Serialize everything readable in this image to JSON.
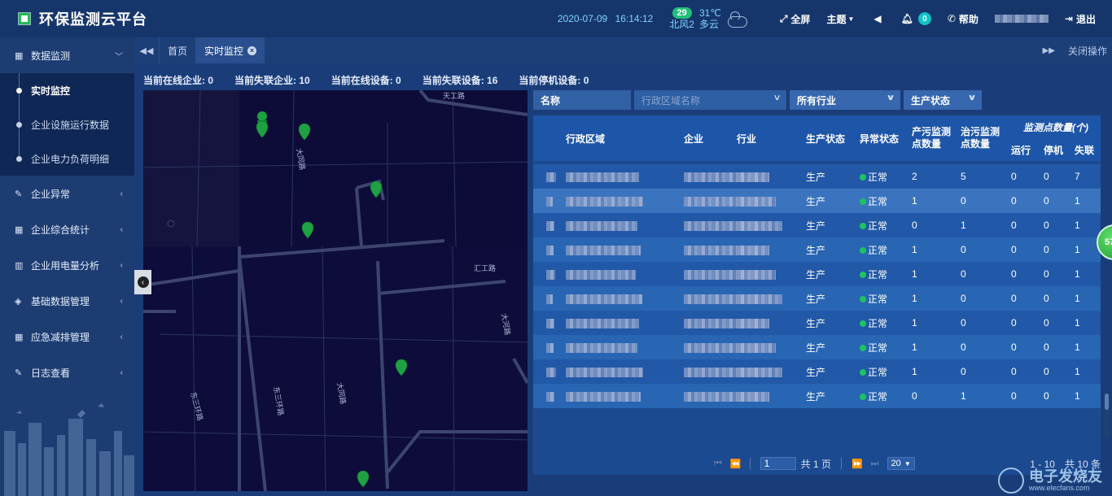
{
  "app": {
    "title": "环保监测云平台"
  },
  "header": {
    "date": "2020-07-09",
    "time": "16:14:12",
    "aqi": "29",
    "wind": "北风2",
    "temperature": "31℃",
    "weather": "多云",
    "fullscreen_label": "全屏",
    "theme_label": "主题",
    "notification_count": "0",
    "help_label": "帮助",
    "logout_label": "退出"
  },
  "sidebar": {
    "groups": [
      {
        "label": "数据监测",
        "icon": "calendar-icon"
      },
      {
        "label": "企业异常",
        "icon": "edit-icon"
      },
      {
        "label": "企业综合统计",
        "icon": "calendar-icon"
      },
      {
        "label": "企业用电量分析",
        "icon": "bar-chart-icon"
      },
      {
        "label": "基础数据管理",
        "icon": "layers-icon"
      },
      {
        "label": "应急减排管理",
        "icon": "calendar-icon"
      },
      {
        "label": "日志查看",
        "icon": "edit-icon"
      }
    ],
    "sub_items": [
      {
        "label": "实时监控"
      },
      {
        "label": "企业设施运行数据"
      },
      {
        "label": "企业电力负荷明细"
      }
    ]
  },
  "tabs": {
    "items": [
      {
        "label": "首页"
      },
      {
        "label": "实时监控"
      }
    ],
    "close_ops_label": "关闭操作"
  },
  "stats": {
    "online_enterprises": "当前在线企业: 0",
    "offline_enterprises": "当前失联企业: 10",
    "online_devices": "当前在线设备: 0",
    "offline_devices": "当前失联设备: 16",
    "stopped_devices": "当前停机设备: 0"
  },
  "map": {
    "road_labels": [
      "天工路",
      "大同路",
      "汇工路",
      "大河路",
      "大同路",
      "东三环路",
      "东三环路"
    ]
  },
  "filters": {
    "name_label": "名称",
    "region_placeholder": "行政区域名称",
    "industry_value": "所有行业",
    "status_value": "生产状态"
  },
  "table": {
    "headers": {
      "region": "行政区域",
      "enterprise": "企业",
      "industry": "行业",
      "prod_status": "生产状态",
      "abnormal_status": "异常状态",
      "pollution_points": "产污监测点数量",
      "treatment_points": "治污监测点数量",
      "monitor_points": "监测点数量(个)",
      "running": "运行",
      "stopped": "停机",
      "offline": "失联"
    },
    "rows": [
      {
        "status": "生产",
        "abnormal": "正常",
        "pollution": "2",
        "treatment": "5",
        "running": "0",
        "stopped": "0",
        "offline": "7"
      },
      {
        "status": "生产",
        "abnormal": "正常",
        "pollution": "1",
        "treatment": "0",
        "running": "0",
        "stopped": "0",
        "offline": "1"
      },
      {
        "status": "生产",
        "abnormal": "正常",
        "pollution": "0",
        "treatment": "1",
        "running": "0",
        "stopped": "0",
        "offline": "1"
      },
      {
        "status": "生产",
        "abnormal": "正常",
        "pollution": "1",
        "treatment": "0",
        "running": "0",
        "stopped": "0",
        "offline": "1"
      },
      {
        "status": "生产",
        "abnormal": "正常",
        "pollution": "1",
        "treatment": "0",
        "running": "0",
        "stopped": "0",
        "offline": "1"
      },
      {
        "status": "生产",
        "abnormal": "正常",
        "pollution": "1",
        "treatment": "0",
        "running": "0",
        "stopped": "0",
        "offline": "1"
      },
      {
        "status": "生产",
        "abnormal": "正常",
        "pollution": "1",
        "treatment": "0",
        "running": "0",
        "stopped": "0",
        "offline": "1"
      },
      {
        "status": "生产",
        "abnormal": "正常",
        "pollution": "1",
        "treatment": "0",
        "running": "0",
        "stopped": "0",
        "offline": "1"
      },
      {
        "status": "生产",
        "abnormal": "正常",
        "pollution": "1",
        "treatment": "0",
        "running": "0",
        "stopped": "0",
        "offline": "1"
      },
      {
        "status": "生产",
        "abnormal": "正常",
        "pollution": "0",
        "treatment": "1",
        "running": "0",
        "stopped": "0",
        "offline": "1"
      }
    ]
  },
  "pagination": {
    "current_page": "1",
    "total_pages_label": "共 1 页",
    "page_size": "20",
    "range_info": "1 - 10　共 10 条"
  },
  "floating_badge": "57",
  "watermark": {
    "title": "电子发烧友",
    "subtitle": "www.elecfans.com"
  }
}
